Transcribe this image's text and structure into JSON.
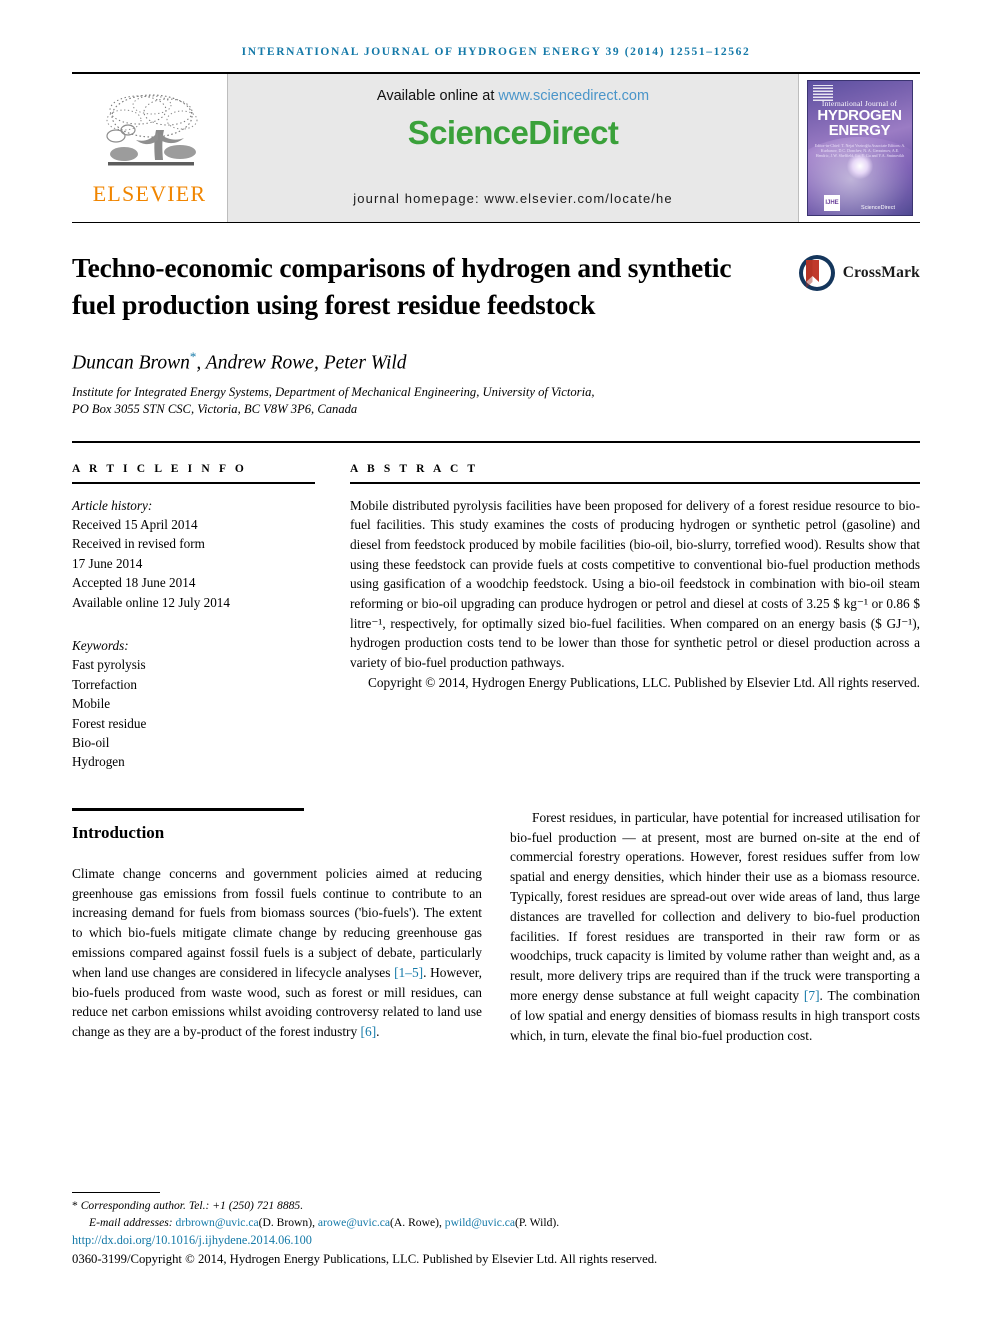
{
  "running_head": "INTERNATIONAL JOURNAL OF HYDROGEN ENERGY 39 (2014) 12551–12562",
  "masthead": {
    "publisher_name": "ELSEVIER",
    "publisher_icon": "elsevier-tree-logo",
    "available_prefix": "Available online at ",
    "available_url": "www.sciencedirect.com",
    "sciencedirect_logo": "ScienceDirect",
    "journal_homepage": "journal homepage: www.elsevier.com/locate/he",
    "cover": {
      "line_small": "International Journal of",
      "line_big_1": "HYDROGEN",
      "line_big_2": "ENERGY",
      "editors": "Editor-in-Chief: T. Nejat Veziroğlu    Associate Editors: A. Kurbanov, D.C. Donchev, N. A. Gerasimov, A.E. Hendric, J.W. Sheffield, Lu. Y. Gu and Y.A. Sminovikh",
      "ijhe_mark": "IJHE",
      "sd_mark": "ScienceDirect"
    }
  },
  "article": {
    "title": "Techno-economic comparisons of hydrogen and synthetic fuel production using forest residue feedstock",
    "crossmark_label": "CrossMark",
    "crossmark_icon": "crossmark-badge-icon",
    "authors": "Duncan Brown",
    "authors_star": "*",
    "authors_rest": ", Andrew Rowe, Peter Wild",
    "affiliation_line1": "Institute for Integrated Energy Systems, Department of Mechanical Engineering, University of Victoria,",
    "affiliation_line2": "PO Box 3055 STN CSC, Victoria, BC V8W 3P6, Canada"
  },
  "article_info": {
    "heading": "A R T I C L E  I N F O",
    "history_label": "Article history:",
    "history": [
      "Received 15 April 2014",
      "Received in revised form",
      "17 June 2014",
      "Accepted 18 June 2014",
      "Available online 12 July 2014"
    ],
    "keywords_label": "Keywords:",
    "keywords": [
      "Fast pyrolysis",
      "Torrefaction",
      "Mobile",
      "Forest residue",
      "Bio-oil",
      "Hydrogen"
    ]
  },
  "abstract": {
    "heading": "A B S T R A C T",
    "text": "Mobile distributed pyrolysis facilities have been proposed for delivery of a forest residue resource to bio-fuel facilities. This study examines the costs of producing hydrogen or synthetic petrol (gasoline) and diesel from feedstock produced by mobile facilities (bio-oil, bio-slurry, torrefied wood). Results show that using these feedstock can provide fuels at costs competitive to conventional bio-fuel production methods using gasification of a woodchip feedstock. Using a bio-oil feedstock in combination with bio-oil steam reforming or bio-oil upgrading can produce hydrogen or petrol and diesel at costs of 3.25 $ kg⁻¹ or 0.86 $ litre⁻¹, respectively, for optimally sized bio-fuel facilities. When compared on an energy basis ($ GJ⁻¹), hydrogen production costs tend to be lower than those for synthetic petrol or diesel production across a variety of bio-fuel production pathways.",
    "copyright": "Copyright © 2014, Hydrogen Energy Publications, LLC. Published by Elsevier Ltd. All rights reserved."
  },
  "introduction": {
    "heading": "Introduction",
    "left_para_1_a": "Climate change concerns and government policies aimed at reducing greenhouse gas emissions from fossil fuels continue to contribute to an increasing demand for fuels from biomass sources ('bio-fuels'). The extent to which bio-fuels mitigate climate change by reducing greenhouse gas emissions compared against fossil fuels is a subject of debate, particularly when land use changes are considered in lifecycle analyses ",
    "left_cite_1": "[1–5]",
    "left_para_1_b": ". However, bio-fuels produced from waste wood, such as forest or mill residues, can reduce net carbon emissions whilst avoiding controversy related to land use change as they are a by-product of the forest industry ",
    "left_cite_2": "[6]",
    "left_para_1_c": ".",
    "right_para_1_a": "Forest residues, in particular, have potential for increased utilisation for bio-fuel production — at present, most are burned on-site at the end of commercial forestry operations. However, forest residues suffer from low spatial and energy densities, which hinder their use as a biomass resource. Typically, forest residues are spread-out over wide areas of land, thus large distances are travelled for collection and delivery to bio-fuel production facilities. If forest residues are transported in their raw form or as woodchips, truck capacity is limited by volume rather than weight and, as a result, more delivery trips are required than if the truck were transporting a more energy dense substance at full weight capacity ",
    "right_cite_1": "[7]",
    "right_para_1_b": ". The combination of low spatial and energy densities of biomass results in high transport costs which, in turn, elevate the final bio-fuel production cost."
  },
  "footnotes": {
    "corresponding_star": "*",
    "corresponding_text": "Corresponding author. Tel.: +1 (250) 721 8885.",
    "email_label": "E-mail addresses:",
    "emails": [
      {
        "address": "drbrown@uvic.ca",
        "name": "(D. Brown)"
      },
      {
        "address": "arowe@uvic.ca",
        "name": "(A. Rowe)"
      },
      {
        "address": "pwild@uvic.ca",
        "name": "(P. Wild)"
      }
    ],
    "doi": "http://dx.doi.org/10.1016/j.ijhydene.2014.06.100",
    "issn_copyright": "0360-3199/Copyright © 2014, Hydrogen Energy Publications, LLC. Published by Elsevier Ltd. All rights reserved."
  },
  "colors": {
    "journal_blue": "#1479a8",
    "sciencedirect_green": "#3aa13a",
    "elsevier_orange": "#f08500",
    "link_blue": "#1479a8"
  }
}
